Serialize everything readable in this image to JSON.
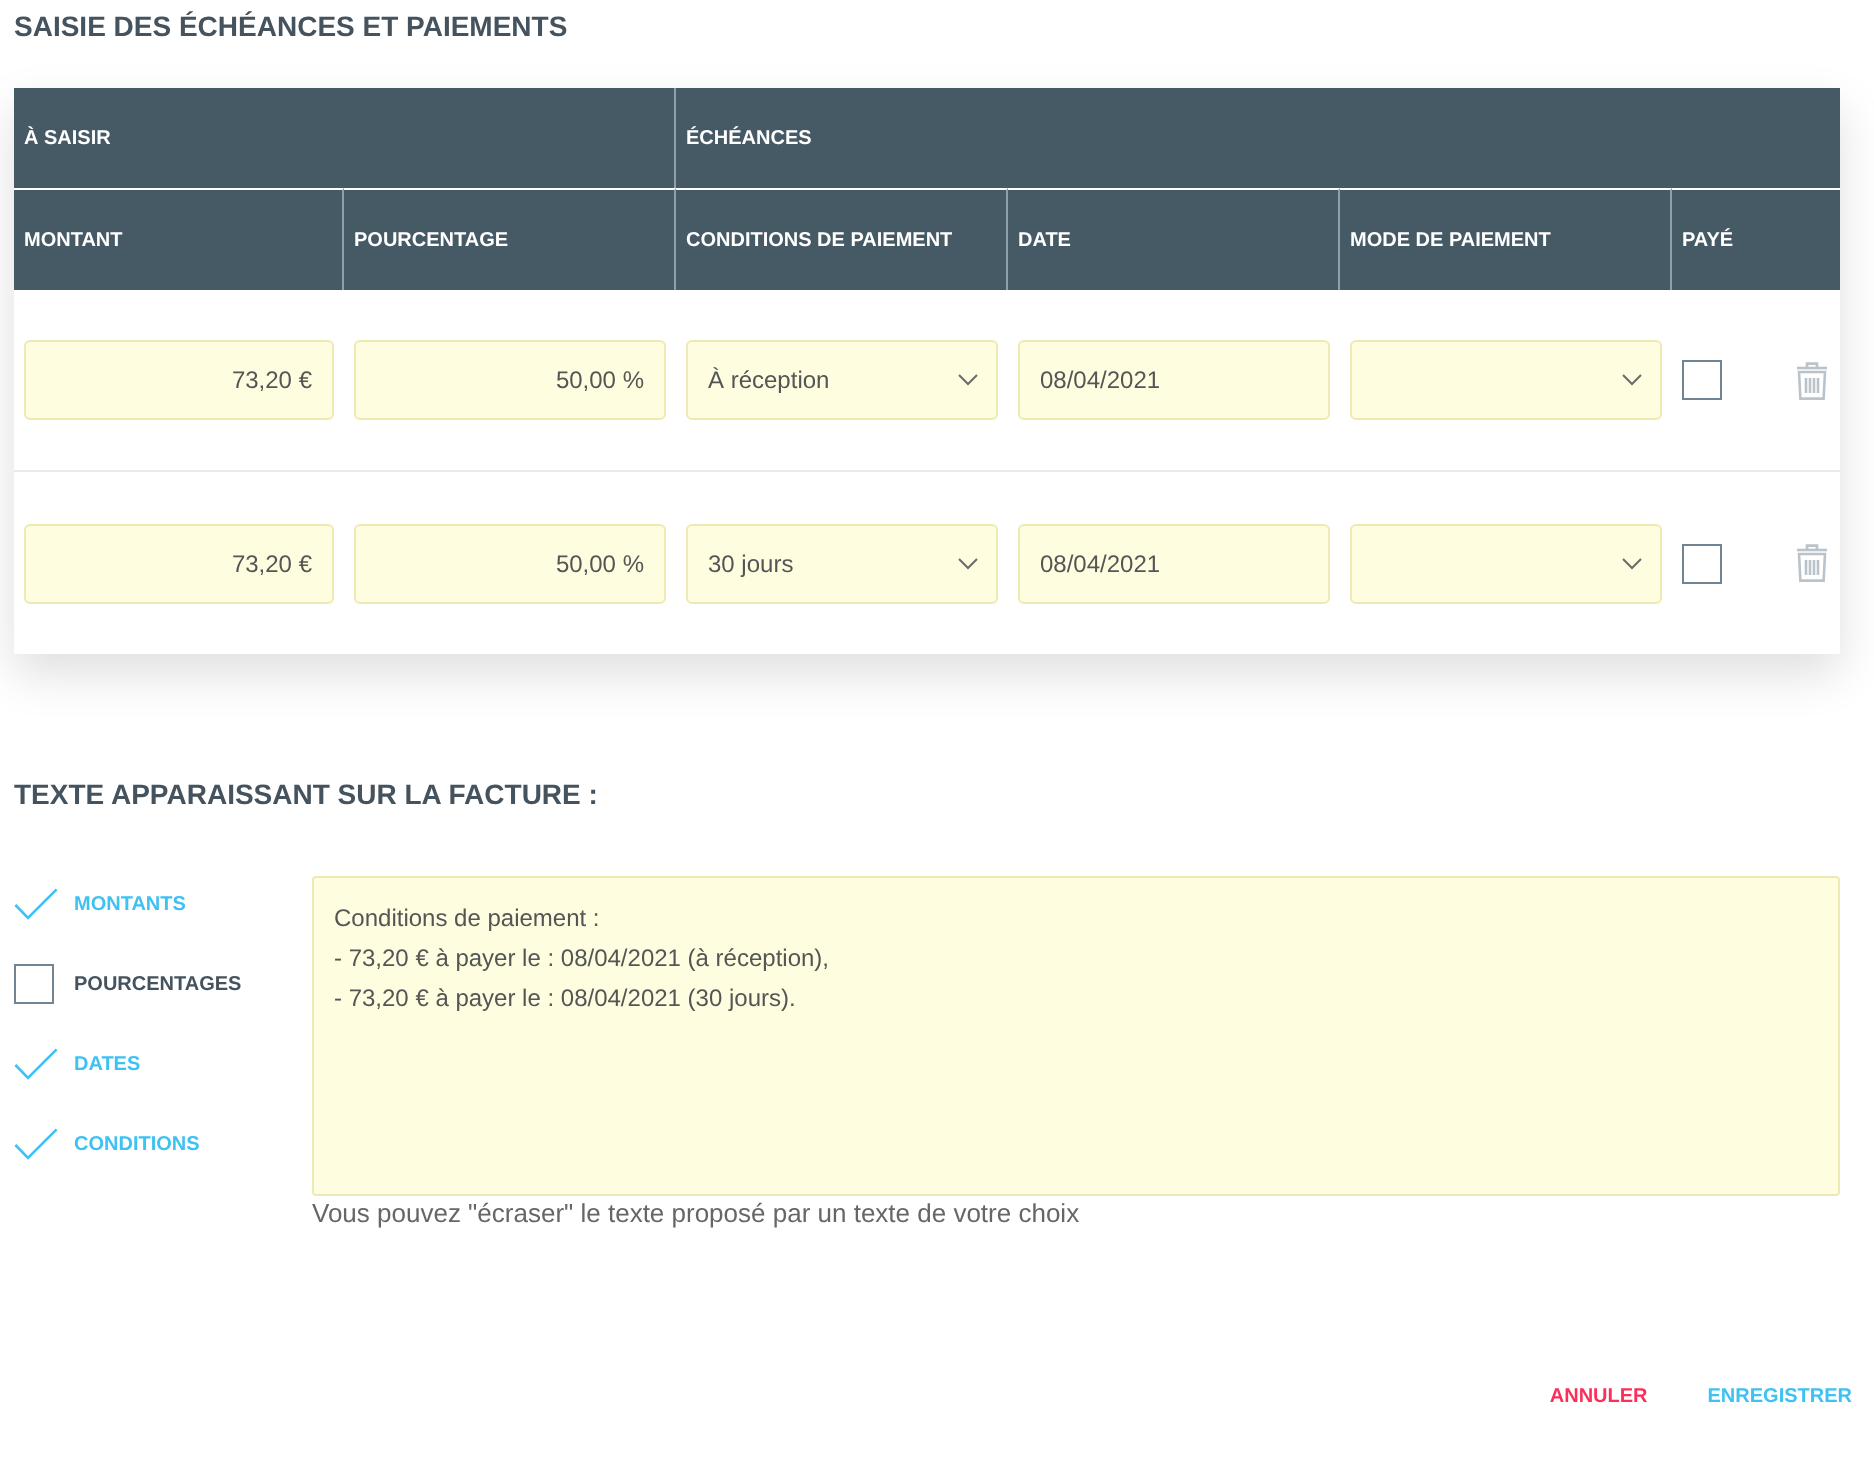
{
  "title": "SAISIE DES ÉCHÉANCES ET PAIEMENTS",
  "table": {
    "column_groups": [
      {
        "label": "À SAISIR",
        "columns": [
          "MONTANT",
          "POURCENTAGE"
        ]
      },
      {
        "label": "ÉCHÉANCES",
        "columns": [
          "CONDITIONS DE PAIEMENT",
          "DATE",
          "MODE DE PAIEMENT",
          "PAYÉ"
        ]
      }
    ],
    "rows": [
      {
        "amount": "73,20 €",
        "percentage": "50,00 %",
        "terms": "À réception",
        "date": "08/04/2021",
        "paid": false
      },
      {
        "amount": "73,20 €",
        "percentage": "50,00 %",
        "terms": "30 jours",
        "date": "08/04/2021",
        "paid": false
      }
    ]
  },
  "invoice_text": {
    "title": "TEXTE APPARAISSANT SUR LA FACTURE :",
    "options": [
      {
        "label": "MONTANTS",
        "checked": true
      },
      {
        "label": "POURCENTAGES",
        "checked": false
      },
      {
        "label": "DATES",
        "checked": true
      },
      {
        "label": "CONDITIONS",
        "checked": true
      }
    ],
    "lines": [
      "Conditions de paiement :",
      "- 73,20 € à payer le : 08/04/2021 (à réception),",
      "- 73,20 € à payer le : 08/04/2021 (30 jours)."
    ],
    "hint": "Vous pouvez \"écraser\" le texte proposé par un texte de votre choix"
  },
  "buttons": [
    {
      "label": "ANNULER",
      "kind": "cancel"
    },
    {
      "label": "ENREGISTRER",
      "kind": "primary"
    }
  ]
}
